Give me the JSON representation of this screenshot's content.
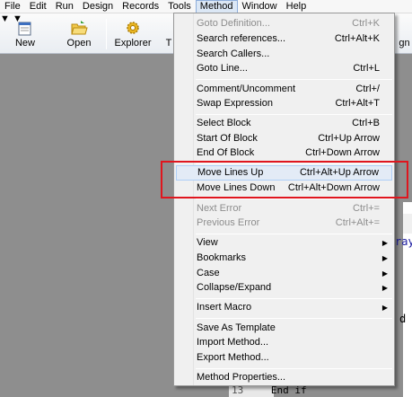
{
  "menubar": [
    "File",
    "Edit",
    "Run",
    "Design",
    "Records",
    "Tools",
    "Method",
    "Window",
    "Help"
  ],
  "toolbar": {
    "new_label": "New",
    "open_label": "Open",
    "explorer_label": "Explorer",
    "partial_label": "T",
    "right_partial_label": "gn"
  },
  "editor": {
    "code_fragment_1": "ray",
    "code_fragment_2": "d",
    "line_number": "13",
    "line_text": "End if"
  },
  "method_menu": {
    "goto_definition": {
      "label": "Goto Definition...",
      "shortcut": "Ctrl+K"
    },
    "search_references": {
      "label": "Search references...",
      "shortcut": "Ctrl+Alt+K"
    },
    "search_callers": {
      "label": "Search Callers..."
    },
    "goto_line": {
      "label": "Goto Line...",
      "shortcut": "Ctrl+L"
    },
    "comment": {
      "label": "Comment/Uncomment",
      "shortcut": "Ctrl+/"
    },
    "swap": {
      "label": "Swap Expression",
      "shortcut": "Ctrl+Alt+T"
    },
    "select_block": {
      "label": "Select Block",
      "shortcut": "Ctrl+B"
    },
    "start_of_block": {
      "label": "Start Of Block",
      "shortcut": "Ctrl+Up Arrow"
    },
    "end_of_block": {
      "label": "End Of Block",
      "shortcut": "Ctrl+Down Arrow"
    },
    "move_up": {
      "label": "Move Lines Up",
      "shortcut": "Ctrl+Alt+Up Arrow"
    },
    "move_down": {
      "label": "Move Lines Down",
      "shortcut": "Ctrl+Alt+Down Arrow"
    },
    "next_error": {
      "label": "Next Error",
      "shortcut": "Ctrl+="
    },
    "prev_error": {
      "label": "Previous Error",
      "shortcut": "Ctrl+Alt+="
    },
    "view": {
      "label": "View"
    },
    "bookmarks": {
      "label": "Bookmarks"
    },
    "case": {
      "label": "Case"
    },
    "collapse": {
      "label": "Collapse/Expand"
    },
    "insert_macro": {
      "label": "Insert Macro"
    },
    "save_template": {
      "label": "Save As Template"
    },
    "import_method": {
      "label": "Import Method..."
    },
    "export_method": {
      "label": "Export Method..."
    },
    "method_properties": {
      "label": "Method Properties..."
    }
  },
  "colors": {
    "highlight_box": "#e0161e",
    "menu_hover": "#e3ebf6"
  }
}
